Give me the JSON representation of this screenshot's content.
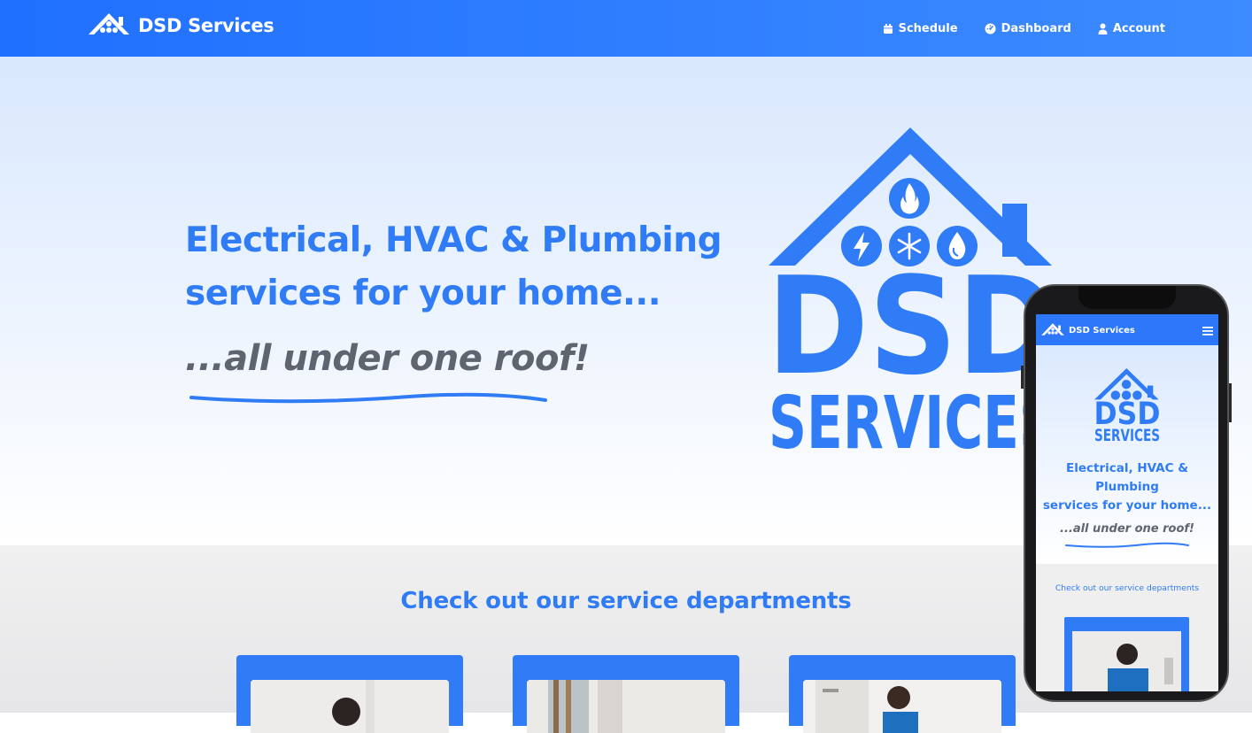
{
  "brand": {
    "name": "DSD Services",
    "logo_icon": "house-logo-icon"
  },
  "nav": {
    "items": [
      {
        "label": "Schedule",
        "icon": "calendar-icon"
      },
      {
        "label": "Dashboard",
        "icon": "dashboard-icon"
      },
      {
        "label": "Account",
        "icon": "user-icon"
      }
    ]
  },
  "hero": {
    "title_line1": "Electrical, HVAC & Plumbing",
    "title_line2": "services for your home...",
    "tagline": "...all under one roof!",
    "logo_text_top": "DSD",
    "logo_text_bottom": "SERVICES"
  },
  "services": {
    "title": "Check out our service departments",
    "cards": [
      {
        "name": "electrical-card"
      },
      {
        "name": "hvac-card"
      },
      {
        "name": "plumbing-card"
      }
    ]
  },
  "mobile": {
    "brand": "DSD Services",
    "title_line1": "Electrical, HVAC &",
    "title_line2": "Plumbing",
    "title_line3": "services for your home...",
    "tagline": "...all under one roof!",
    "services_title": "Check out our service departments",
    "logo_text_top": "DSD",
    "logo_text_bottom": "SERVICES"
  },
  "colors": {
    "brand_blue": "#2f7cf6",
    "nav_blue": "#2070ff",
    "tagline_gray": "#5e6470"
  }
}
